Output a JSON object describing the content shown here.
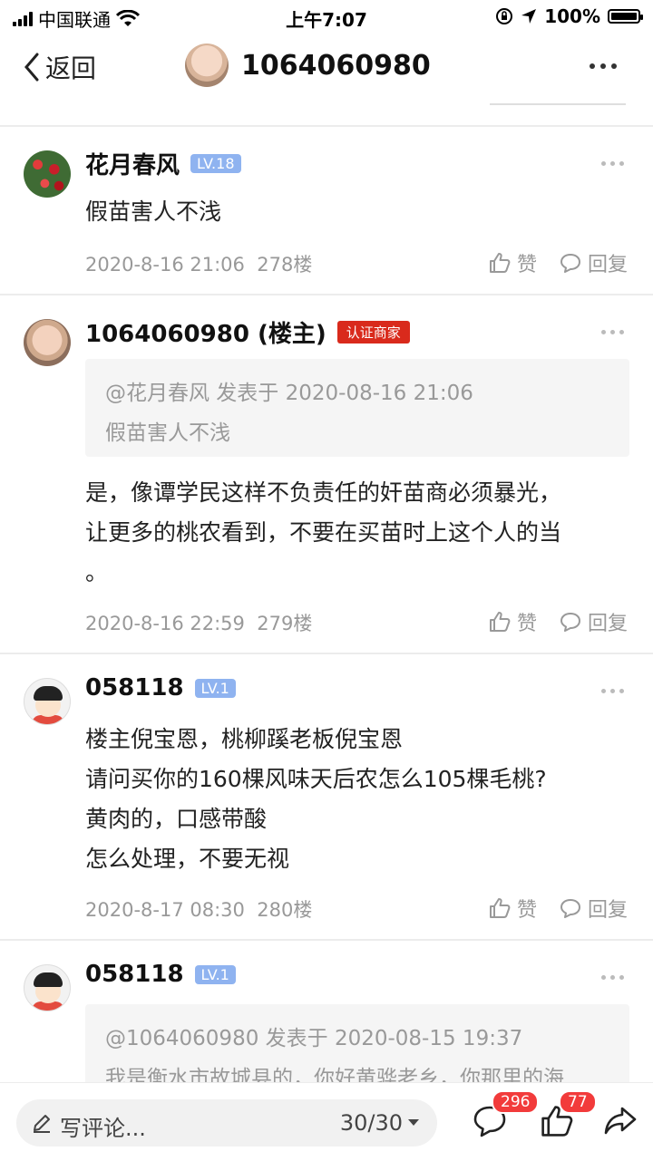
{
  "status_bar": {
    "carrier": "中国联通",
    "time": "上午7:07",
    "battery": "100%"
  },
  "header": {
    "back_label": "返回",
    "title": "1064060980"
  },
  "posts": [
    {
      "user": "花月春风",
      "level": "LV.18",
      "content": "假苗害人不浅",
      "date": "2020-8-16 21:06",
      "floor": "278楼",
      "like_label": "赞",
      "reply_label": "回复"
    },
    {
      "user": "1064060980 (楼主)",
      "badge": "认证商家",
      "quote_header": "@花月春风 发表于 2020-08-16 21:06",
      "quote_text": "假苗害人不浅",
      "content_lines": [
        "是，像谭学民这样不负责任的奸苗商必须暴光，",
        "让更多的桃农看到，不要在买苗时上这个人的当",
        "。"
      ],
      "date": "2020-8-16 22:59",
      "floor": "279楼",
      "like_label": "赞",
      "reply_label": "回复"
    },
    {
      "user": "058118",
      "level": "LV.1",
      "content_lines": [
        "楼主倪宝恩，桃柳蹊老板倪宝恩",
        "请问买你的160棵风味天后农怎么105棵毛桃?",
        "黄肉的，口感带酸",
        "怎么处理，不要无视"
      ],
      "date": "2020-8-17 08:30",
      "floor": "280楼",
      "like_label": "赞",
      "reply_label": "回复"
    },
    {
      "user": "058118",
      "level": "LV.1",
      "quote_header": "@1064060980 发表于 2020-08-15 19:37",
      "quote_text": "我是衡水市故城县的，你好黄骅老乡，你那里的海"
    }
  ],
  "bottom_bar": {
    "comment_placeholder": "写评论...",
    "page": "30/30",
    "comment_count": "296",
    "like_count": "77"
  }
}
